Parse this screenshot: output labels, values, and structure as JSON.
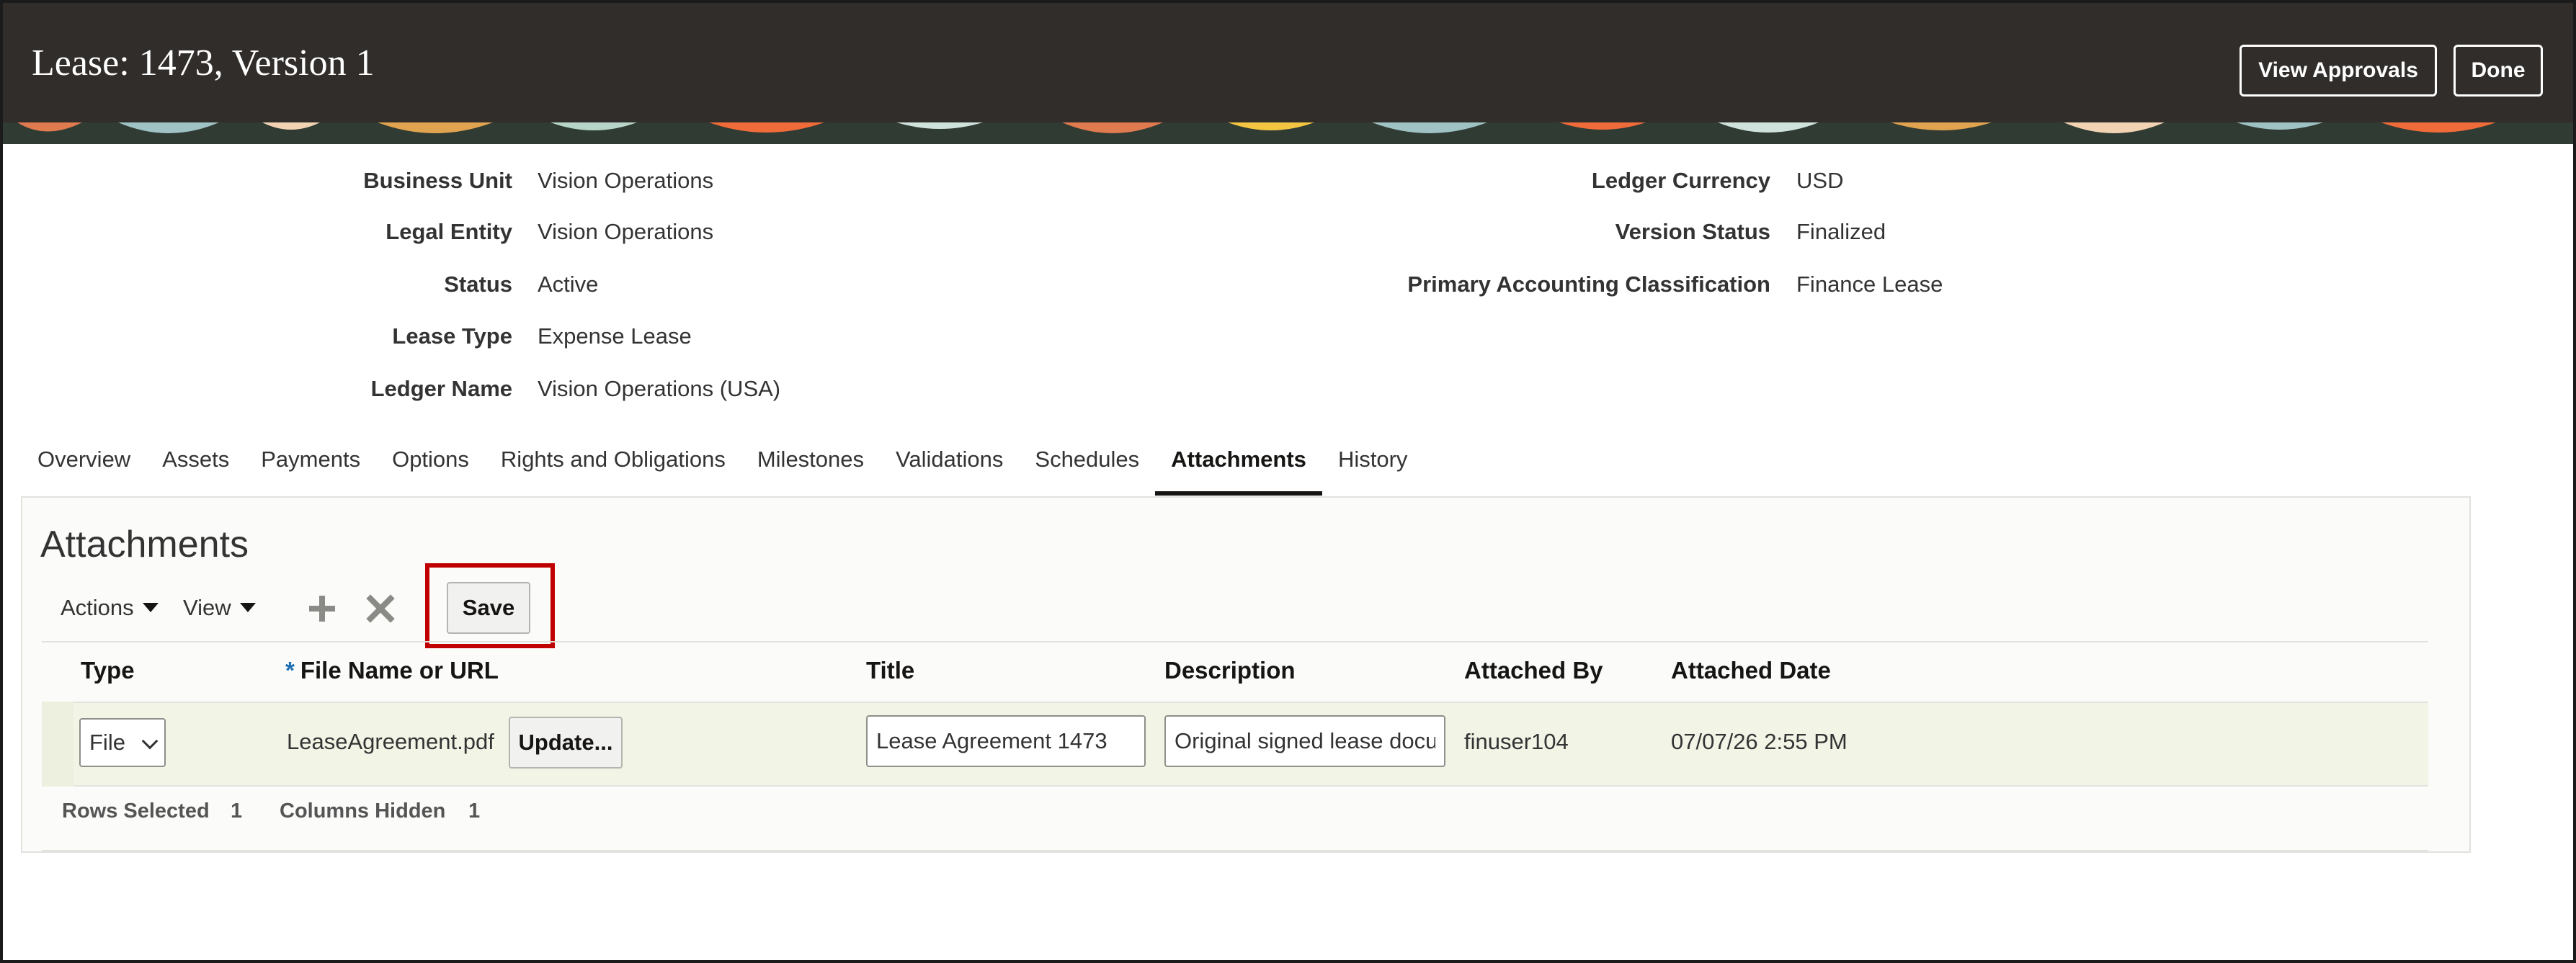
{
  "header": {
    "title": "Lease: 1473, Version 1",
    "view_approvals_label": "View Approvals",
    "done_label": "Done",
    "colors": {
      "background": "#312d2a",
      "text": "#ffffff"
    }
  },
  "details": {
    "left": [
      {
        "label": "Business Unit",
        "value": "Vision Operations"
      },
      {
        "label": "Legal Entity",
        "value": "Vision Operations"
      },
      {
        "label": "Status",
        "value": "Active"
      },
      {
        "label": "Lease Type",
        "value": "Expense Lease"
      },
      {
        "label": "Ledger Name",
        "value": "Vision Operations (USA)"
      }
    ],
    "right": [
      {
        "label": "Ledger Currency",
        "value": "USD"
      },
      {
        "label": "Version Status",
        "value": "Finalized"
      },
      {
        "label": "Primary Accounting Classification",
        "value": "Finance Lease"
      }
    ]
  },
  "tabs": [
    {
      "label": "Overview"
    },
    {
      "label": "Assets"
    },
    {
      "label": "Payments"
    },
    {
      "label": "Options"
    },
    {
      "label": "Rights and Obligations"
    },
    {
      "label": "Milestones"
    },
    {
      "label": "Validations"
    },
    {
      "label": "Schedules"
    },
    {
      "label": "Attachments",
      "active": true
    },
    {
      "label": "History"
    }
  ],
  "attachments": {
    "section_title": "Attachments",
    "toolbar": {
      "actions_label": "Actions",
      "view_label": "View",
      "add_icon": "plus-icon",
      "delete_icon": "close-icon",
      "save_label": "Save",
      "highlight_color": "#c00000"
    },
    "columns": {
      "type": "Type",
      "file_name": "File Name or URL",
      "required_marker": "*",
      "title": "Title",
      "description": "Description",
      "attached_by": "Attached By",
      "attached_date": "Attached Date"
    },
    "rows": [
      {
        "type": "File",
        "file_name": "LeaseAgreement.pdf",
        "update_label": "Update...",
        "title": "Lease Agreement 1473",
        "description": "Original signed lease docu",
        "attached_by": "finuser104",
        "attached_date": "07/07/26 2:55 PM"
      }
    ],
    "footer": {
      "rows_selected_label": "Rows Selected",
      "rows_selected_value": "1",
      "columns_hidden_label": "Columns Hidden",
      "columns_hidden_value": "1"
    }
  }
}
